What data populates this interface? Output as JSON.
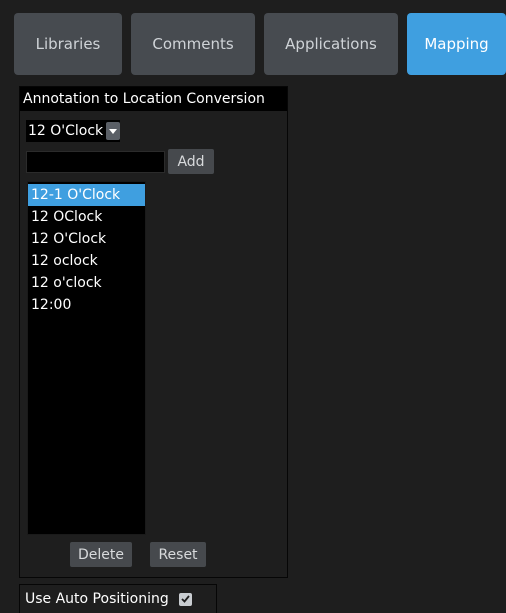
{
  "tabs": [
    {
      "label": "Libraries",
      "active": false
    },
    {
      "label": "Comments",
      "active": false
    },
    {
      "label": "Applications",
      "active": false
    },
    {
      "label": "Mapping",
      "active": true
    }
  ],
  "colors": {
    "accent": "#3f9fe0",
    "tab_inactive": "#474b50",
    "background": "#1e1e1e"
  },
  "panel": {
    "title": "Annotation to Location Conversion",
    "select": {
      "value": "12 O'Clock",
      "icon": "chevron-down-icon"
    },
    "input": {
      "value": "",
      "placeholder": ""
    },
    "add_label": "Add",
    "list": {
      "items": [
        "12-1 O'Clock",
        "12 OClock",
        "12 O'Clock",
        "12 oclock",
        "12 o'clock",
        "12:00"
      ],
      "selected": "12-1 O'Clock"
    },
    "delete_label": "Delete",
    "reset_label": "Reset"
  },
  "auto_positioning": {
    "label": "Use Auto Positioning",
    "checked": true,
    "icon": "checkmark-icon"
  }
}
